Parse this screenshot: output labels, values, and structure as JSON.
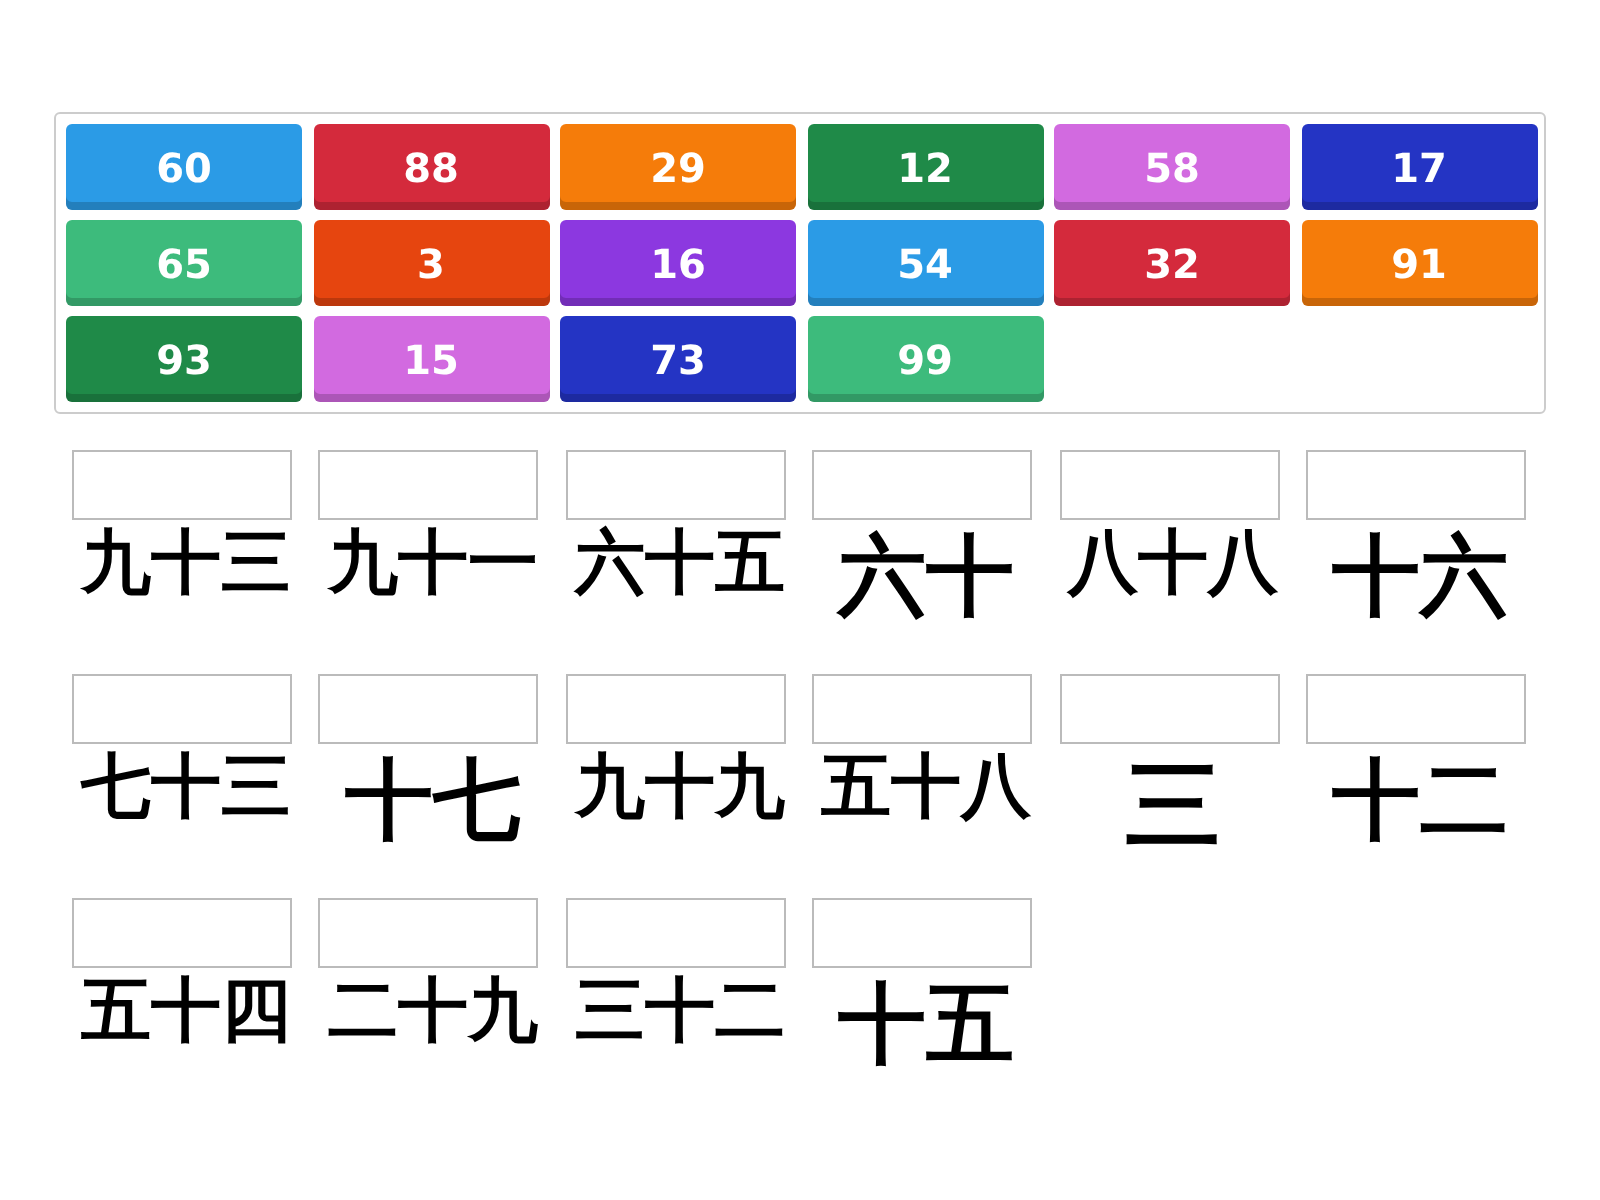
{
  "tiles": [
    {
      "label": "60",
      "color": "#2b9be6"
    },
    {
      "label": "88",
      "color": "#d42a3c"
    },
    {
      "label": "29",
      "color": "#f57c0a"
    },
    {
      "label": "12",
      "color": "#1f8a48"
    },
    {
      "label": "58",
      "color": "#d26ae0"
    },
    {
      "label": "17",
      "color": "#2434c4"
    },
    {
      "label": "65",
      "color": "#3dbb7c"
    },
    {
      "label": "3",
      "color": "#e6450f"
    },
    {
      "label": "16",
      "color": "#8c38e0"
    },
    {
      "label": "54",
      "color": "#2b9be6"
    },
    {
      "label": "32",
      "color": "#d42a3c"
    },
    {
      "label": "91",
      "color": "#f57c0a"
    },
    {
      "label": "93",
      "color": "#1f8a48"
    },
    {
      "label": "15",
      "color": "#d26ae0"
    },
    {
      "label": "73",
      "color": "#2434c4"
    },
    {
      "label": "99",
      "color": "#3dbb7c"
    }
  ],
  "slots": [
    {
      "label": "九十三"
    },
    {
      "label": "九十一"
    },
    {
      "label": "六十五"
    },
    {
      "label": "六十"
    },
    {
      "label": "八十八"
    },
    {
      "label": "十六"
    },
    {
      "label": "七十三"
    },
    {
      "label": "十七"
    },
    {
      "label": "九十九"
    },
    {
      "label": "五十八"
    },
    {
      "label": "三"
    },
    {
      "label": "十二"
    },
    {
      "label": "五十四"
    },
    {
      "label": "二十九"
    },
    {
      "label": "三十二"
    },
    {
      "label": "十五"
    }
  ]
}
